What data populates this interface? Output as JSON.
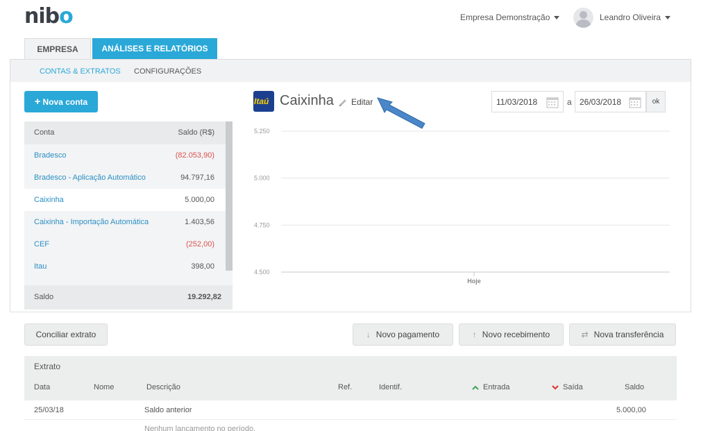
{
  "brand": {
    "logo_prefix": "nib",
    "logo_suffix": "o"
  },
  "header": {
    "company": "Empresa Demonstração",
    "user": "Leandro Oliveira"
  },
  "tabs": [
    {
      "label": "EMPRESA"
    },
    {
      "label": "ANÁLISES E RELATÓRIOS"
    }
  ],
  "subnav": [
    {
      "label": "CONTAS & EXTRATOS"
    },
    {
      "label": "CONFIGURAÇÕES"
    }
  ],
  "accounts": {
    "new_button": "Nova conta",
    "col_name": "Conta",
    "col_balance": "Saldo (R$)",
    "rows": [
      {
        "name": "Bradesco",
        "balance": "(82.053,90)"
      },
      {
        "name": "Bradesco - Aplicação Automático",
        "balance": "94.797,16"
      },
      {
        "name": "Caixinha",
        "balance": "5.000,00"
      },
      {
        "name": "Caixinha - Importação Automática",
        "balance": "1.403,56"
      },
      {
        "name": "CEF",
        "balance": "(252,00)"
      },
      {
        "name": "Itau",
        "balance": "398,00"
      }
    ],
    "total_label": "Saldo",
    "total_value": "19.292,82"
  },
  "account_detail": {
    "bank_logo": "Itaú",
    "title": "Caixinha",
    "edit_label": "Editar",
    "date_from": "11/03/2018",
    "date_sep": "a",
    "date_to": "26/03/2018",
    "ok_label": "ok"
  },
  "chart_data": {
    "type": "line",
    "y_ticks": [
      "5.250",
      "5.000",
      "4.750",
      "4.500"
    ],
    "ylim": [
      4500,
      5250
    ],
    "x_labels": [
      "Hoje"
    ],
    "series": []
  },
  "actions": {
    "conciliar": "Conciliar extrato",
    "pagamento": "Novo pagamento",
    "recebimento": "Novo recebimento",
    "transferencia": "Nova transferência"
  },
  "extrato": {
    "title": "Extrato",
    "columns": {
      "data": "Data",
      "nome": "Nome",
      "descricao": "Descrição",
      "ref": "Ref.",
      "identif": "Identif.",
      "entrada": "Entrada",
      "saida": "Saída",
      "saldo": "Saldo"
    },
    "rows": [
      {
        "data": "25/03/18",
        "descricao": "Saldo anterior",
        "saldo": "5.000,00"
      }
    ],
    "empty_message": "Nenhum lançamento no período."
  },
  "colors": {
    "accent": "#2aa8d8",
    "negative": "#d9534f",
    "entrada": "#3aa55b",
    "saida": "#d9302b",
    "arrow": "#4a86c8"
  }
}
